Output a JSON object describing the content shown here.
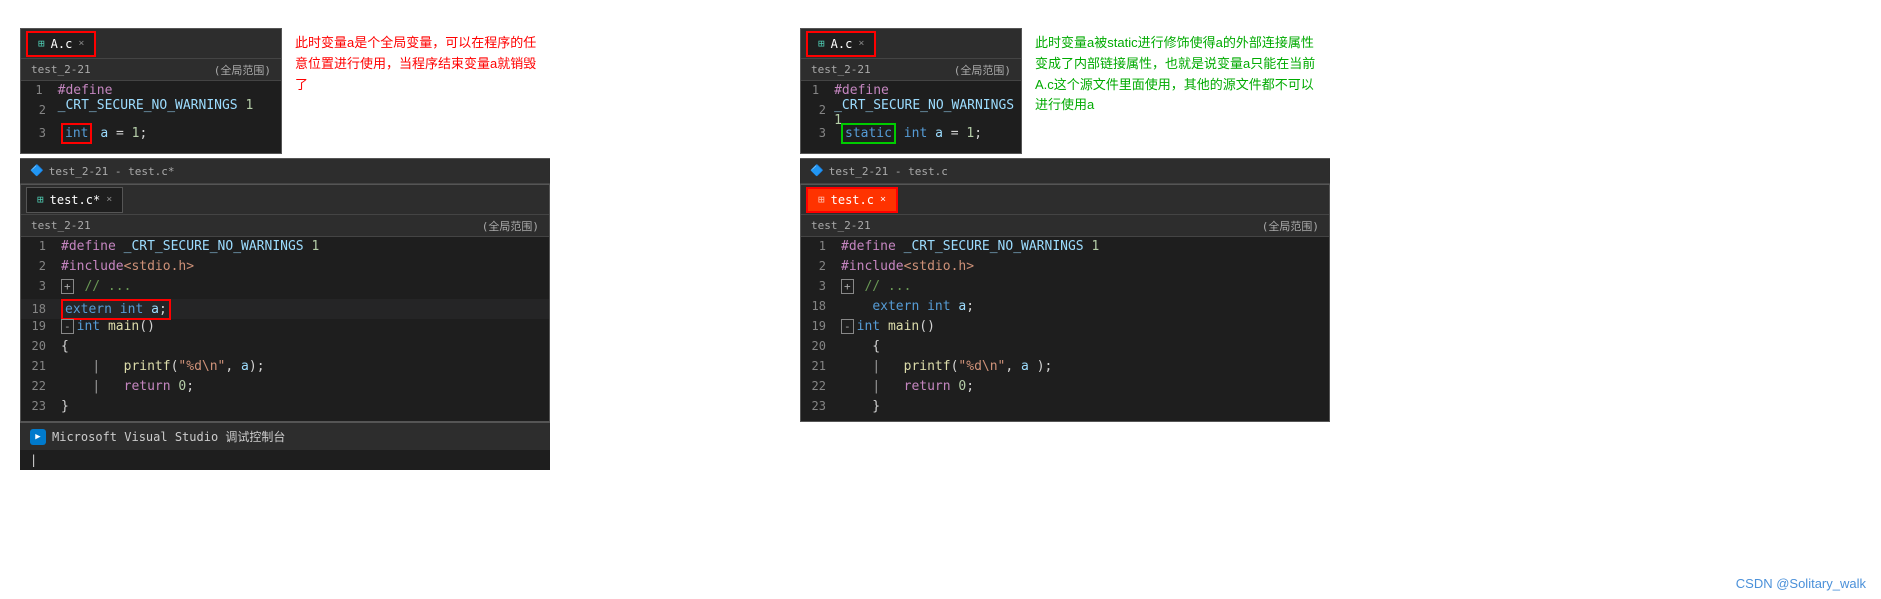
{
  "left": {
    "top_editor": {
      "tab_label": "A.c",
      "tab_close": "×",
      "breadcrumb_left": "test_2-21",
      "breadcrumb_right": "(全局范围)",
      "lines": [
        {
          "num": "1",
          "content": "#define _CRT_SECURE_NO_WARNINGS 1"
        },
        {
          "num": "2",
          "content": ""
        },
        {
          "num": "3",
          "content": "int a = 1;"
        }
      ]
    },
    "annotation_top": "此时变量a是个全局变量，可以在程序的任意位置进行使用，当程序结束变量a就销毁了",
    "split_bar_label": "test_2-21 - test.c*",
    "bottom_editor": {
      "tab_label": "test.c*",
      "tab_close": "×",
      "breadcrumb_left": "test_2-21",
      "breadcrumb_right": "(全局范围)",
      "lines": [
        {
          "num": "1",
          "content": "#define _CRT_SECURE_NO_WARNINGS 1"
        },
        {
          "num": "2",
          "content": "#include<stdio.h>"
        },
        {
          "num": "3",
          "content": "// ..."
        },
        {
          "num": "18",
          "content": "extern int a;"
        },
        {
          "num": "19",
          "content": "int main()"
        },
        {
          "num": "20",
          "content": "{"
        },
        {
          "num": "21",
          "content": "    printf(\"%d\\n\", a);"
        },
        {
          "num": "22",
          "content": "    return 0;"
        },
        {
          "num": "23",
          "content": "}"
        }
      ]
    },
    "debug_bar_label": "Microsoft Visual Studio 调试控制台"
  },
  "right": {
    "top_editor": {
      "tab_label": "A.c",
      "tab_close": "×",
      "breadcrumb_left": "test_2-21",
      "breadcrumb_right": "(全局范围)",
      "lines": [
        {
          "num": "1",
          "content": "#define _CRT_SECURE_NO_WARNINGS 1"
        },
        {
          "num": "2",
          "content": ""
        },
        {
          "num": "3",
          "content": "static int a = 1;"
        }
      ]
    },
    "annotation_top": "此时变量a被static进行修饰使得a的外部连接属性变成了内部链接属性，也就是说变量a只能在当前 A.c这个源文件里面使用，其他的源文件都不可以进行使用a",
    "split_bar_label": "test_2-21 - test.c",
    "bottom_editor": {
      "tab_label": "test.c",
      "tab_close": "×",
      "breadcrumb_left": "test_2-21",
      "breadcrumb_right": "(全局范围)",
      "lines": [
        {
          "num": "1",
          "content": "#define _CRT_SECURE_NO_WARNINGS 1"
        },
        {
          "num": "2",
          "content": "#include<stdio.h>"
        },
        {
          "num": "3",
          "content": "// ..."
        },
        {
          "num": "18",
          "content": "extern int a;"
        },
        {
          "num": "19",
          "content": "int main()"
        },
        {
          "num": "20",
          "content": "{"
        },
        {
          "num": "21",
          "content": "    printf(\"%d\\n\", a );"
        },
        {
          "num": "22",
          "content": "    return 0;"
        },
        {
          "num": "23",
          "content": "}"
        }
      ]
    }
  },
  "watermark": "CSDN @Solitary_walk"
}
